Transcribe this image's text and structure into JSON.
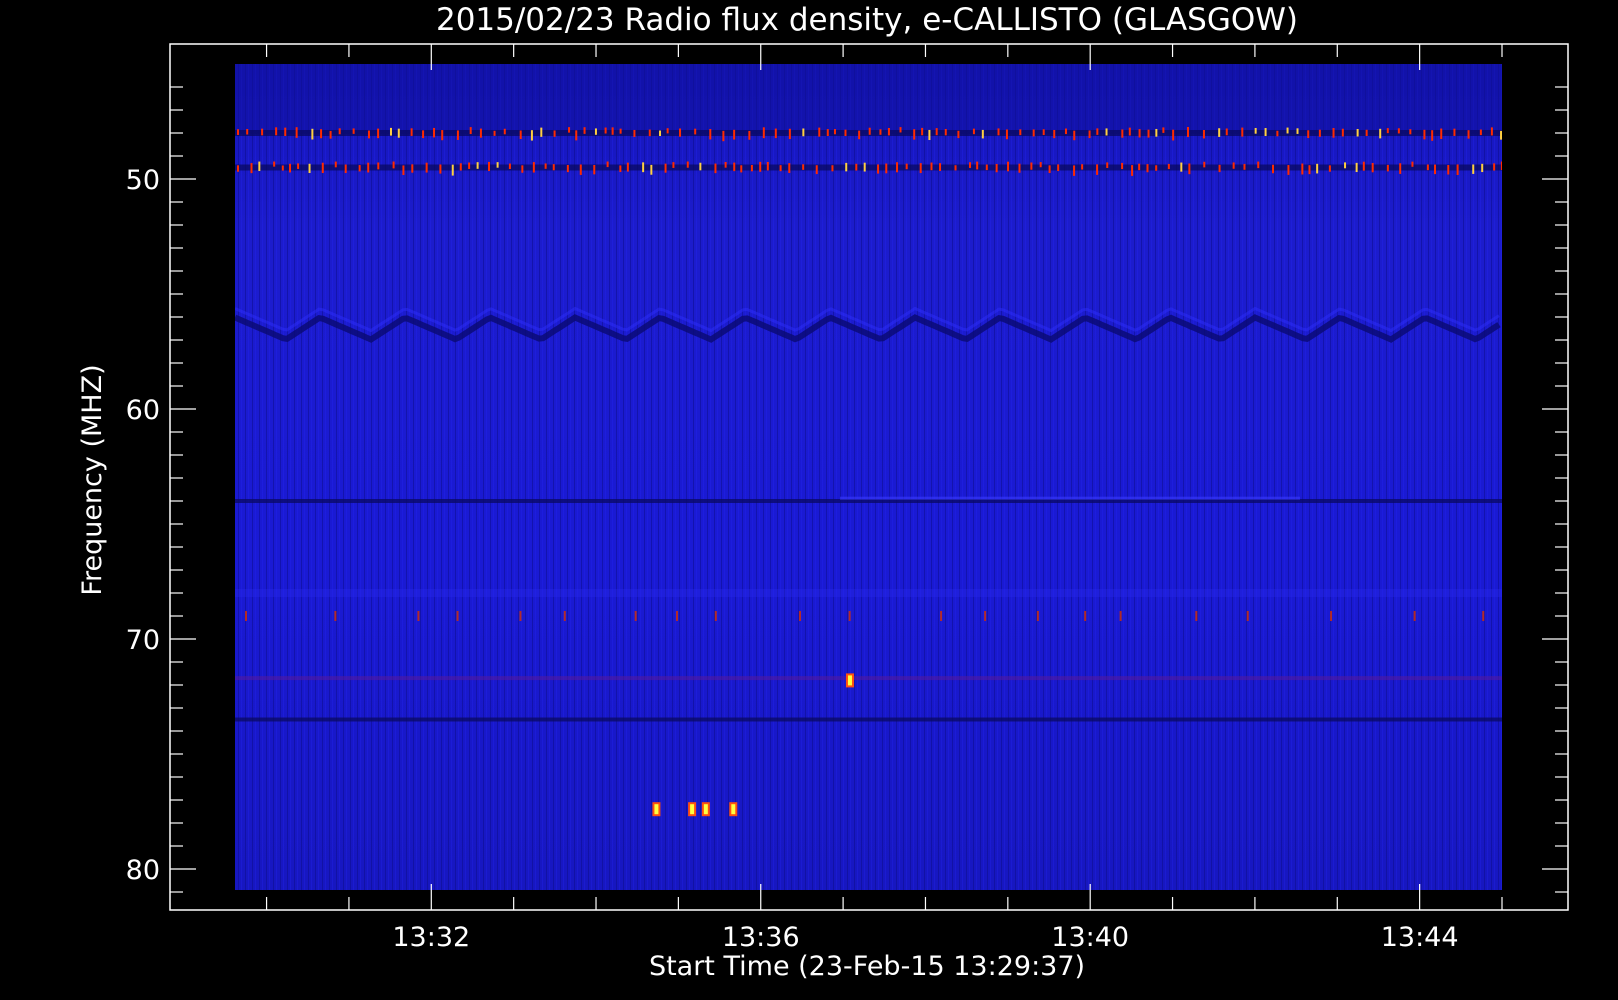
{
  "chart_data": {
    "type": "heatmap",
    "title": "2015/02/23  Radio flux density, e-CALLISTO (GLASGOW)",
    "xlabel": "Start Time (23-Feb-15 13:29:37)",
    "ylabel": "Frequency (MHZ)",
    "x_range": [
      "13:29:37",
      "13:45:00"
    ],
    "y_range": [
      45,
      81
    ],
    "y_inverted": true,
    "x_ticks": [
      "13:32",
      "13:36",
      "13:40",
      "13:44"
    ],
    "y_ticks": [
      50,
      60,
      70,
      80
    ],
    "grid": false,
    "colors": {
      "background": "#000000",
      "low": "#1a1acc",
      "mid": "#ff2a00",
      "high": "#ffff40"
    },
    "features": [
      {
        "name": "interference-band-48",
        "freq_mhz": 48.0
      },
      {
        "name": "interference-band-49.5",
        "freq_mhz": 49.5
      },
      {
        "name": "wavy-dark-band",
        "freq_mhz": 56.5
      },
      {
        "name": "dark-line",
        "freq_mhz": 64.0
      },
      {
        "name": "dark-line",
        "freq_mhz": 73.5
      }
    ],
    "bright_spots": [
      {
        "time": "13:34:44",
        "freq_mhz": 77.4
      },
      {
        "time": "13:35:10",
        "freq_mhz": 77.4
      },
      {
        "time": "13:35:20",
        "freq_mhz": 77.4
      },
      {
        "time": "13:35:40",
        "freq_mhz": 77.4
      },
      {
        "time": "13:37:05",
        "freq_mhz": 71.8
      }
    ]
  }
}
